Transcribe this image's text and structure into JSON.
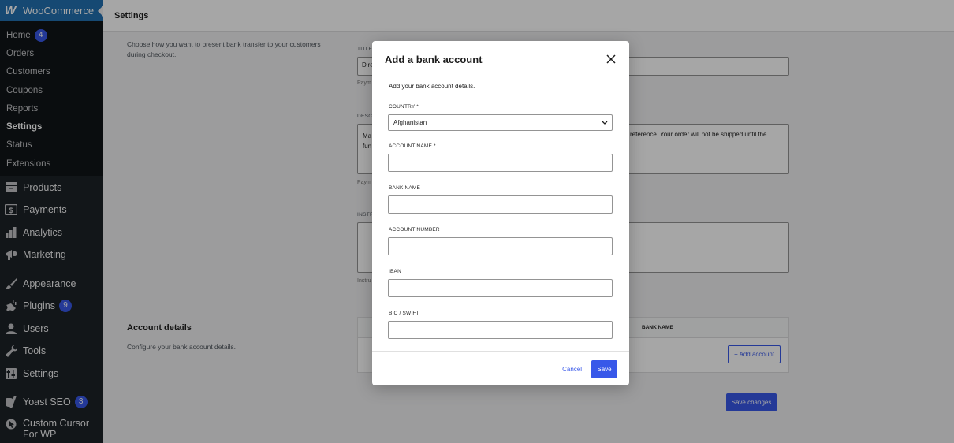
{
  "sidebar": {
    "brand": "WooCommerce",
    "submenu": [
      {
        "label": "Home",
        "badge": "4"
      },
      {
        "label": "Orders"
      },
      {
        "label": "Customers"
      },
      {
        "label": "Coupons"
      },
      {
        "label": "Reports"
      },
      {
        "label": "Settings",
        "active": true
      },
      {
        "label": "Status"
      },
      {
        "label": "Extensions"
      }
    ],
    "menu": [
      {
        "label": "Products",
        "icon": "archive-icon"
      },
      {
        "label": "Payments",
        "icon": "dollar-icon"
      },
      {
        "label": "Analytics",
        "icon": "bar-chart-icon"
      },
      {
        "label": "Marketing",
        "icon": "megaphone-icon"
      },
      {
        "label": "Appearance",
        "icon": "paintbrush-icon"
      },
      {
        "label": "Plugins",
        "icon": "plug-icon",
        "badge": "9"
      },
      {
        "label": "Users",
        "icon": "user-icon"
      },
      {
        "label": "Tools",
        "icon": "wrench-icon"
      },
      {
        "label": "Settings",
        "icon": "sliders-icon"
      },
      {
        "label": "Yoast SEO",
        "icon": "yoast-icon",
        "badge": "3"
      },
      {
        "label": "Custom Cursor For WP",
        "icon": "cursor-icon"
      }
    ]
  },
  "header": {
    "title": "Settings"
  },
  "background": {
    "intro": "Choose how you want to present bank transfer to your customers during checkout.",
    "title_label": "TITLE",
    "title_value": "Dire",
    "title_help": "Paym",
    "desc_label": "DESCR",
    "desc_value_left": "Ma fun",
    "desc_value_right": "reference. Your order will not be shipped until the",
    "desc_help": "Paym",
    "instr_label": "INSTR",
    "instr_help": "Instru",
    "account_section_title": "Account details",
    "account_section_desc": "Configure your bank account details.",
    "table_col_bank_name": "BANK NAME",
    "add_account": "+ Add account",
    "save_changes": "Save changes"
  },
  "modal": {
    "title": "Add a bank account",
    "intro": "Add your bank account details.",
    "country_label": "COUNTRY *",
    "country_value": "Afghanistan",
    "account_name_label": "ACCOUNT NAME *",
    "bank_name_label": "BANK NAME",
    "account_number_label": "ACCOUNT NUMBER",
    "iban_label": "IBAN",
    "bic_label": "BIC / SWIFT",
    "cancel": "Cancel",
    "save": "Save"
  },
  "colors": {
    "accent": "#3858e9",
    "sidebar": "#1d2327",
    "brand": "#2271b1"
  }
}
